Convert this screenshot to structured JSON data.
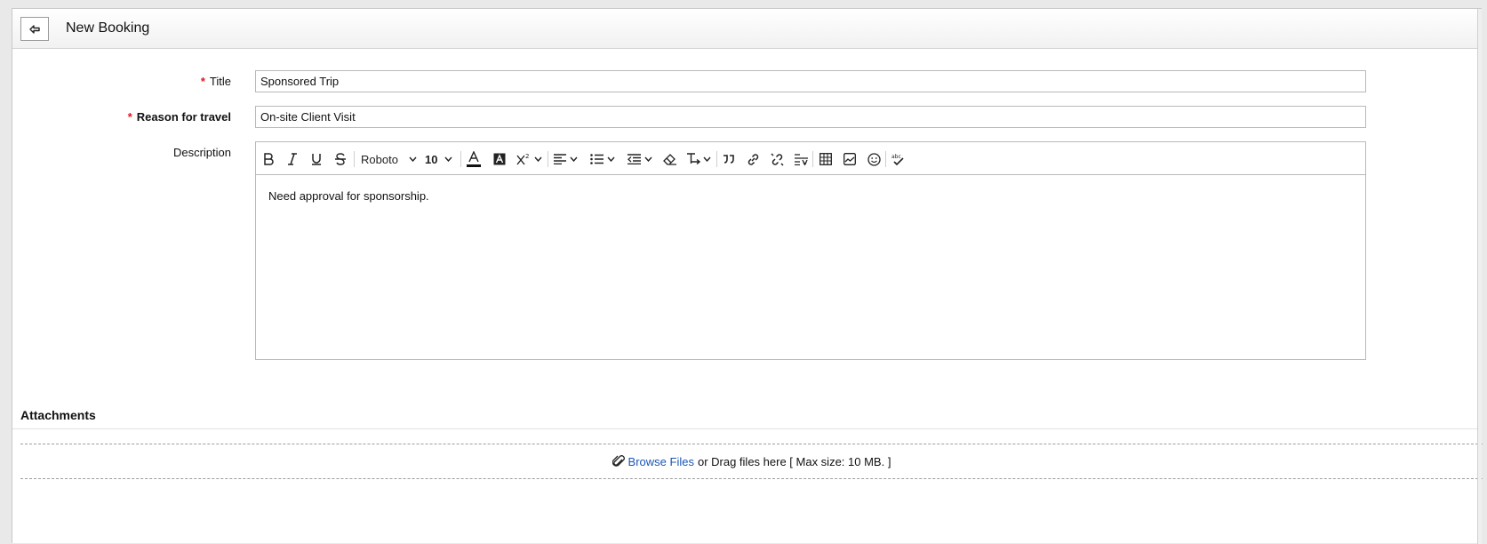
{
  "header": {
    "title": "New Booking"
  },
  "form": {
    "title_label": "Title",
    "title_value": "Sponsored Trip",
    "reason_label": "Reason for travel",
    "reason_value": "On-site Client Visit",
    "description_label": "Description",
    "required_mark": "*"
  },
  "editor": {
    "font_family": "Roboto",
    "font_size": "10",
    "content": "Need approval for sponsorship.",
    "tools": [
      "bold-icon",
      "italic-icon",
      "underline-icon",
      "strikethrough-icon",
      "font-family-select",
      "font-size-select",
      "text-color-icon",
      "background-color-icon",
      "superscript-icon",
      "align-icon",
      "list-icon",
      "indent-icon",
      "clear-format-icon",
      "text-direction-icon",
      "quote-icon",
      "link-icon",
      "unlink-icon",
      "line-height-icon",
      "table-icon",
      "image-icon",
      "emoji-icon",
      "spellcheck-icon"
    ]
  },
  "attachments": {
    "title": "Attachments",
    "browse_label": "Browse Files",
    "drag_text": "or Drag files here [ Max size: 10 MB. ]"
  },
  "colors": {
    "required": "#e0171f",
    "link": "#1a56b8"
  }
}
